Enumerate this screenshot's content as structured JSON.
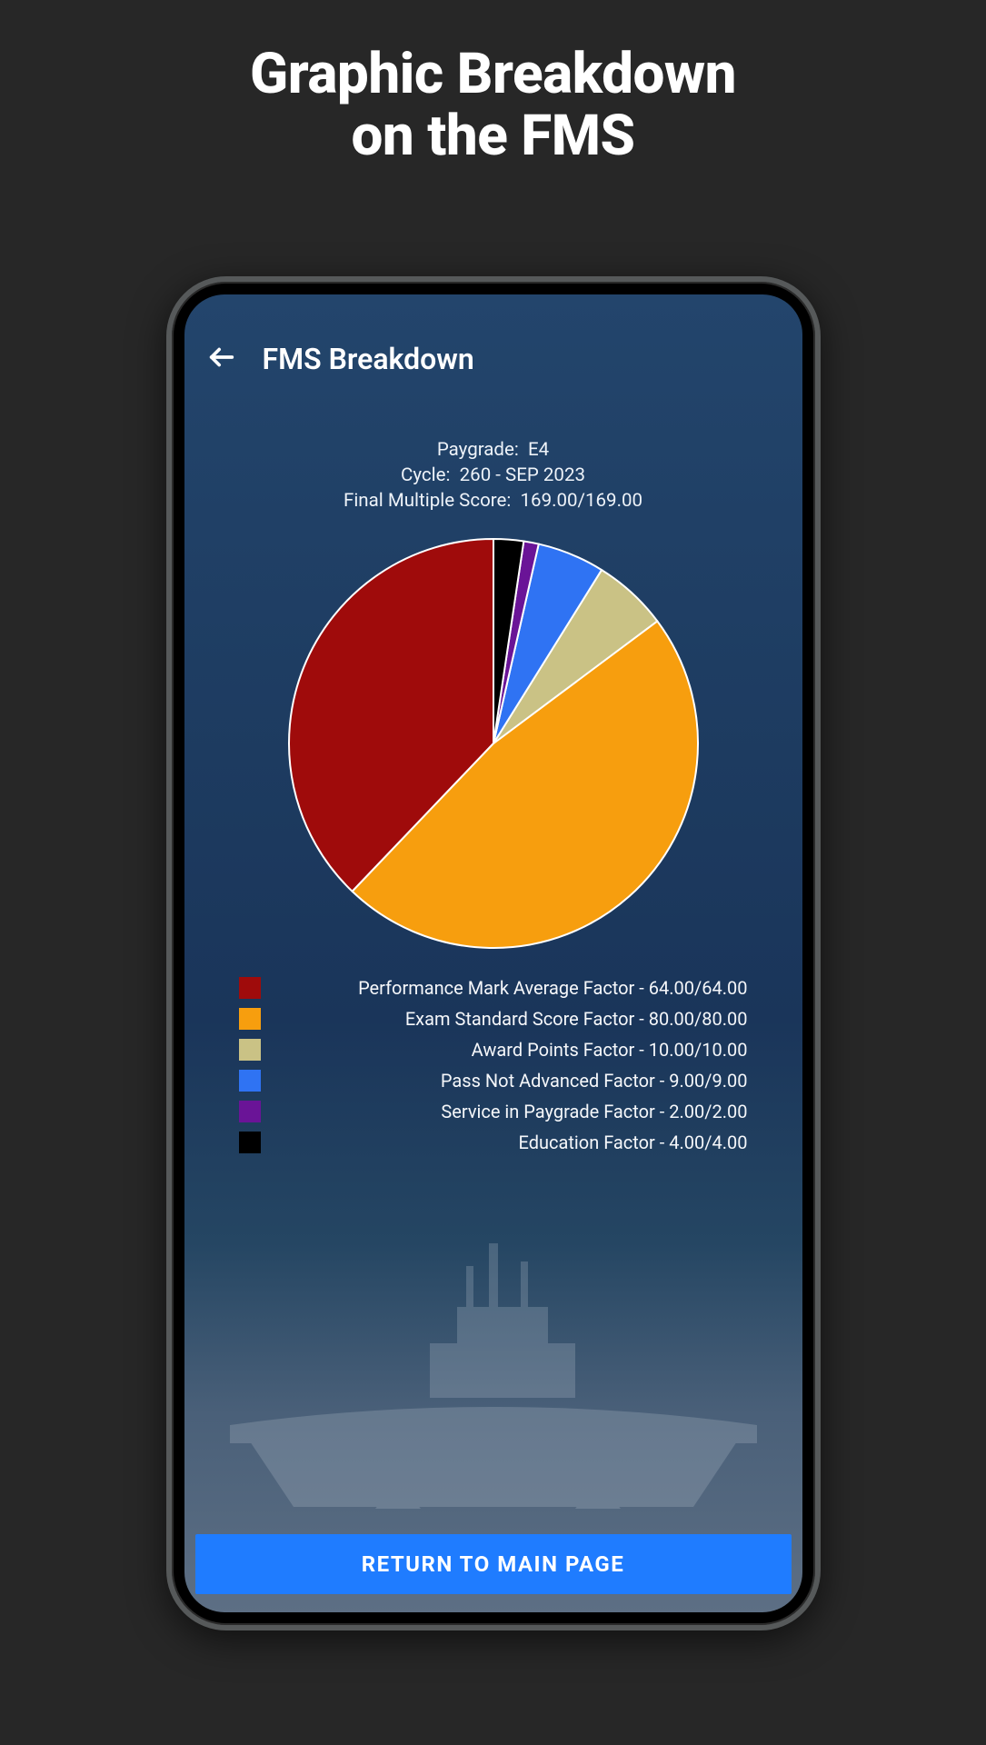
{
  "marketing": {
    "title_line1": "Graphic Breakdown",
    "title_line2": "on the FMS"
  },
  "appbar": {
    "title": "FMS Breakdown"
  },
  "summary": {
    "paygrade_label": "Paygrade:",
    "paygrade_value": "E4",
    "cycle_label": "Cycle:",
    "cycle_value": "260 - SEP 2023",
    "fms_label": "Final Multiple Score:",
    "fms_value": "169.00/169.00"
  },
  "button": {
    "return_label": "RETURN TO MAIN PAGE"
  },
  "legend": [
    {
      "color": "#9f0b0b",
      "label": "Performance Mark Average Factor - 64.00/64.00"
    },
    {
      "color": "#f79e0e",
      "label": "Exam Standard Score Factor - 80.00/80.00"
    },
    {
      "color": "#cac285",
      "label": "Award Points Factor - 10.00/10.00"
    },
    {
      "color": "#2f73f3",
      "label": "Pass Not Advanced Factor - 9.00/9.00"
    },
    {
      "color": "#6a1497",
      "label": "Service in Paygrade Factor - 2.00/2.00"
    },
    {
      "color": "#000000",
      "label": "Education Factor - 4.00/4.00"
    }
  ],
  "chart_data": {
    "type": "pie",
    "title": "FMS Breakdown",
    "total": 169.0,
    "series": [
      {
        "name": "Performance Mark Average Factor",
        "value": 64.0,
        "max": 64.0,
        "color": "#9f0b0b"
      },
      {
        "name": "Exam Standard Score Factor",
        "value": 80.0,
        "max": 80.0,
        "color": "#f79e0e"
      },
      {
        "name": "Award Points Factor",
        "value": 10.0,
        "max": 10.0,
        "color": "#cac285"
      },
      {
        "name": "Pass Not Advanced Factor",
        "value": 9.0,
        "max": 9.0,
        "color": "#2f73f3"
      },
      {
        "name": "Service in Paygrade Factor",
        "value": 2.0,
        "max": 2.0,
        "color": "#6a1497"
      },
      {
        "name": "Education Factor",
        "value": 4.0,
        "max": 4.0,
        "color": "#000000"
      }
    ],
    "start_angle_deg": 90,
    "direction": "counterclockwise"
  }
}
